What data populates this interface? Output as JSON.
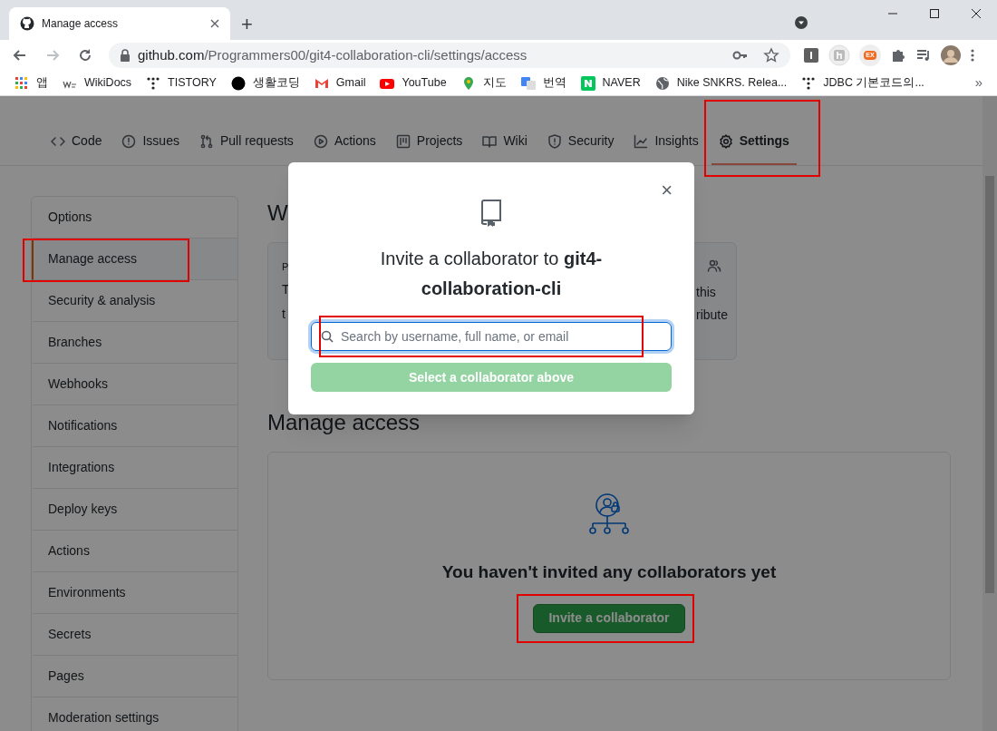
{
  "browser": {
    "tab_title": "Manage access",
    "new_tab": "+",
    "url_host": "github.com",
    "url_path": "/Programmers00/git4-collaboration-cli/settings/access",
    "bookmarks": [
      {
        "label": "앱",
        "kind": "apps"
      },
      {
        "label": "WikiDocs",
        "kind": "wiki"
      },
      {
        "label": "TISTORY",
        "kind": "dots"
      },
      {
        "label": "생활코딩",
        "kind": "circle"
      },
      {
        "label": "Gmail",
        "kind": "gmail"
      },
      {
        "label": "YouTube",
        "kind": "youtube"
      },
      {
        "label": "지도",
        "kind": "pin"
      },
      {
        "label": "번역",
        "kind": "translate"
      },
      {
        "label": "NAVER",
        "kind": "naver"
      },
      {
        "label": "Nike SNKRS. Relea...",
        "kind": "globe"
      },
      {
        "label": "JDBC 기본코드의...",
        "kind": "dots"
      }
    ],
    "more": "»",
    "extension_badge": "EX"
  },
  "repo_tabs": [
    {
      "label": "Code",
      "selected": false,
      "highlighted": false
    },
    {
      "label": "Issues",
      "selected": false,
      "highlighted": false
    },
    {
      "label": "Pull requests",
      "selected": false,
      "highlighted": false
    },
    {
      "label": "Actions",
      "selected": false,
      "highlighted": false
    },
    {
      "label": "Projects",
      "selected": false,
      "highlighted": false
    },
    {
      "label": "Wiki",
      "selected": false,
      "highlighted": false
    },
    {
      "label": "Security",
      "selected": false,
      "highlighted": false
    },
    {
      "label": "Insights",
      "selected": false,
      "highlighted": false
    },
    {
      "label": "Settings",
      "selected": true,
      "highlighted": true
    }
  ],
  "sidebar": {
    "items": [
      {
        "label": "Options",
        "selected": false,
        "highlighted": false
      },
      {
        "label": "Manage access",
        "selected": true,
        "highlighted": true
      },
      {
        "label": "Security & analysis",
        "selected": false,
        "highlighted": false
      },
      {
        "label": "Branches",
        "selected": false,
        "highlighted": false
      },
      {
        "label": "Webhooks",
        "selected": false,
        "highlighted": false
      },
      {
        "label": "Notifications",
        "selected": false,
        "highlighted": false
      },
      {
        "label": "Integrations",
        "selected": false,
        "highlighted": false
      },
      {
        "label": "Deploy keys",
        "selected": false,
        "highlighted": false
      },
      {
        "label": "Actions",
        "selected": false,
        "highlighted": false
      },
      {
        "label": "Environments",
        "selected": false,
        "highlighted": false
      },
      {
        "label": "Secrets",
        "selected": false,
        "highlighted": false
      },
      {
        "label": "Pages",
        "selected": false,
        "highlighted": false
      },
      {
        "label": "Moderation settings",
        "selected": false,
        "highlighted": false
      }
    ]
  },
  "main": {
    "heading_fragment": "W",
    "card": {
      "left_fragments": [
        "P",
        "T",
        "t"
      ],
      "right_fragments": [
        "this",
        "ribute"
      ]
    },
    "manage_heading": "Manage access",
    "empty_message": "You haven't invited any collaborators yet",
    "invite_button": {
      "label": "Invite a collaborator",
      "highlighted": true
    }
  },
  "modal": {
    "close": "×",
    "title": "Invite a collaborator to **git4-collaboration-cli**",
    "search": {
      "placeholder": "Search by username, full name, or email",
      "highlighted": true
    },
    "submit": {
      "label": "Select a collaborator above",
      "disabled": true
    }
  }
}
